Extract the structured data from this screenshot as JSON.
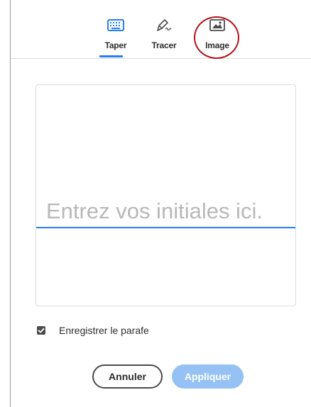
{
  "tabs": {
    "items": [
      {
        "label": "Taper",
        "icon": "keyboard-icon",
        "selected": true
      },
      {
        "label": "Tracer",
        "icon": "pen-draw-icon",
        "selected": false
      },
      {
        "label": "Image",
        "icon": "image-icon",
        "selected": false
      }
    ]
  },
  "canvas": {
    "placeholder": "Entrez vos initiales ici.",
    "value": ""
  },
  "save": {
    "label": "Enregistrer le parafe",
    "checked": true
  },
  "buttons": {
    "cancel_label": "Annuler",
    "apply_label": "Appliquer"
  },
  "colors": {
    "accent": "#2680eb",
    "apply_disabled": "#95c1f4",
    "annotation_circle": "#b1131b"
  }
}
